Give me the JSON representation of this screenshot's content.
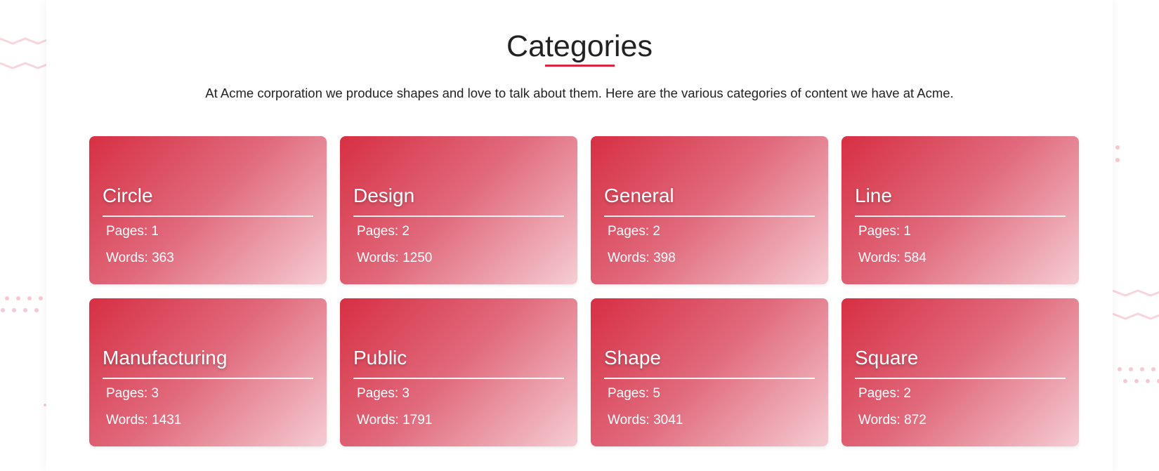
{
  "header": {
    "title": "Categories",
    "intro": "At Acme corporation we produce shapes and love to talk about them. Here are the various categories of content we have at Acme."
  },
  "colors": {
    "accent": "#d7263d",
    "card_gradient_start": "#d72f43",
    "card_gradient_end": "#f5cdd4"
  },
  "categories": [
    {
      "name": "Circle",
      "pages": "Pages: 1",
      "words": "Words: 363"
    },
    {
      "name": "Design",
      "pages": "Pages: 2",
      "words": "Words: 1250"
    },
    {
      "name": "General",
      "pages": "Pages: 2",
      "words": "Words: 398"
    },
    {
      "name": "Line",
      "pages": "Pages: 1",
      "words": "Words: 584"
    },
    {
      "name": "Manufacturing",
      "pages": "Pages: 3",
      "words": "Words: 1431"
    },
    {
      "name": "Public",
      "pages": "Pages: 3",
      "words": "Words: 1791"
    },
    {
      "name": "Shape",
      "pages": "Pages: 5",
      "words": "Words: 3041"
    },
    {
      "name": "Square",
      "pages": "Pages: 2",
      "words": "Words: 872"
    }
  ]
}
